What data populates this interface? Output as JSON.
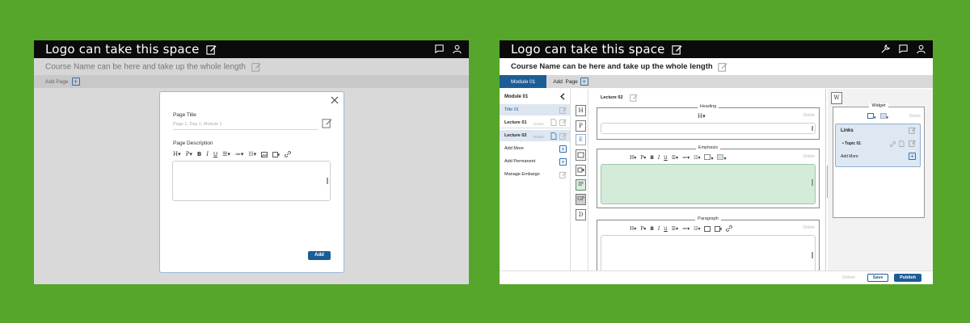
{
  "left_screen": {
    "logo": "Logo can take this space",
    "course_name": "Course Name can be here and take up the whole length",
    "add_page": "Add Page",
    "modal": {
      "page_title_label": "Page Title",
      "page_title_placeholder": "Page 1, Day 1, Module 1",
      "page_description_label": "Page Description",
      "toolbar_h": "H",
      "toolbar_p": "P",
      "toolbar_b": "B",
      "toolbar_i": "I",
      "toolbar_u": "U",
      "add_button": "Add"
    }
  },
  "right_screen": {
    "logo": "Logo can take this space",
    "course_name": "Course Name can be here and take up the whole length",
    "module_tab": "Module 01",
    "add_page": "Add  Page",
    "sidebar": {
      "module_title": "Module 01",
      "items": [
        {
          "label": "Title 01"
        },
        {
          "label": "Lecture 01",
          "delete": "Delete"
        },
        {
          "label": "Lecture 02",
          "delete": "Delete"
        },
        {
          "label": "Add More"
        },
        {
          "label": "Add Permanent"
        },
        {
          "label": "Manage Embargo"
        }
      ]
    },
    "blocks": [
      "H",
      "P",
      "E",
      "IP",
      "GP",
      "D"
    ],
    "lecture_title": "Lecture 02",
    "sections": [
      {
        "title": "Heading",
        "delete": "Delete"
      },
      {
        "title": "Emphasis",
        "delete": "Delete"
      },
      {
        "title": "Paragraph",
        "delete": "Delete"
      }
    ],
    "toolbar": {
      "h": "H",
      "p": "P",
      "b": "B",
      "i": "I",
      "u": "U"
    },
    "widget": {
      "w_button": "W",
      "title": "Widget",
      "delete": "Delete",
      "links_title": "Links",
      "topic": "Topic 01",
      "add_more": "Add More"
    },
    "bottom": {
      "delete": "Delete",
      "save": "Save",
      "publish": "Publish"
    }
  },
  "colors": {
    "background": "#55a62a",
    "topbar": "#0b0b0b",
    "accent": "#1d5d96",
    "emphasis_fill": "#d3ebd8"
  }
}
